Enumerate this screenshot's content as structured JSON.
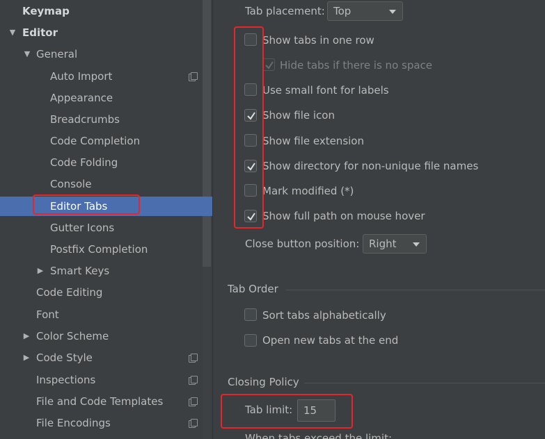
{
  "sidebar": {
    "items": [
      {
        "label": "Keymap"
      },
      {
        "label": "Editor"
      },
      {
        "label": "General"
      },
      {
        "label": "Auto Import"
      },
      {
        "label": "Appearance"
      },
      {
        "label": "Breadcrumbs"
      },
      {
        "label": "Code Completion"
      },
      {
        "label": "Code Folding"
      },
      {
        "label": "Console"
      },
      {
        "label": "Editor Tabs"
      },
      {
        "label": "Gutter Icons"
      },
      {
        "label": "Postfix Completion"
      },
      {
        "label": "Smart Keys"
      },
      {
        "label": "Code Editing"
      },
      {
        "label": "Font"
      },
      {
        "label": "Color Scheme"
      },
      {
        "label": "Code Style"
      },
      {
        "label": "Inspections"
      },
      {
        "label": "File and Code Templates"
      },
      {
        "label": "File Encodings"
      }
    ],
    "selected": "Editor Tabs"
  },
  "content": {
    "tab_placement": {
      "label": "Tab placement:",
      "value": "Top"
    },
    "options": [
      {
        "label": "Show tabs in one row",
        "checked": false
      },
      {
        "label": "Hide tabs if there is no space",
        "checked": true,
        "disabled": true
      },
      {
        "label": "Use small font for labels",
        "checked": false
      },
      {
        "label": "Show file icon",
        "checked": true
      },
      {
        "label": "Show file extension",
        "checked": false
      },
      {
        "label": "Show directory for non-unique file names",
        "checked": true
      },
      {
        "label": "Mark modified (*)",
        "checked": false
      },
      {
        "label": "Show full path on mouse hover",
        "checked": true
      }
    ],
    "close_button": {
      "label": "Close button position:",
      "value": "Right"
    },
    "tab_order": {
      "title": "Tab Order",
      "options": [
        {
          "label": "Sort tabs alphabetically",
          "checked": false
        },
        {
          "label": "Open new tabs at the end",
          "checked": false
        }
      ]
    },
    "closing_policy": {
      "title": "Closing Policy",
      "tab_limit_label": "Tab limit:",
      "tab_limit_value": "15",
      "exceed_label": "When tabs exceed the limit:"
    }
  },
  "colors": {
    "background": "#3c3f41",
    "selection": "#4b6eaf",
    "highlight_box": "#e8262a"
  }
}
